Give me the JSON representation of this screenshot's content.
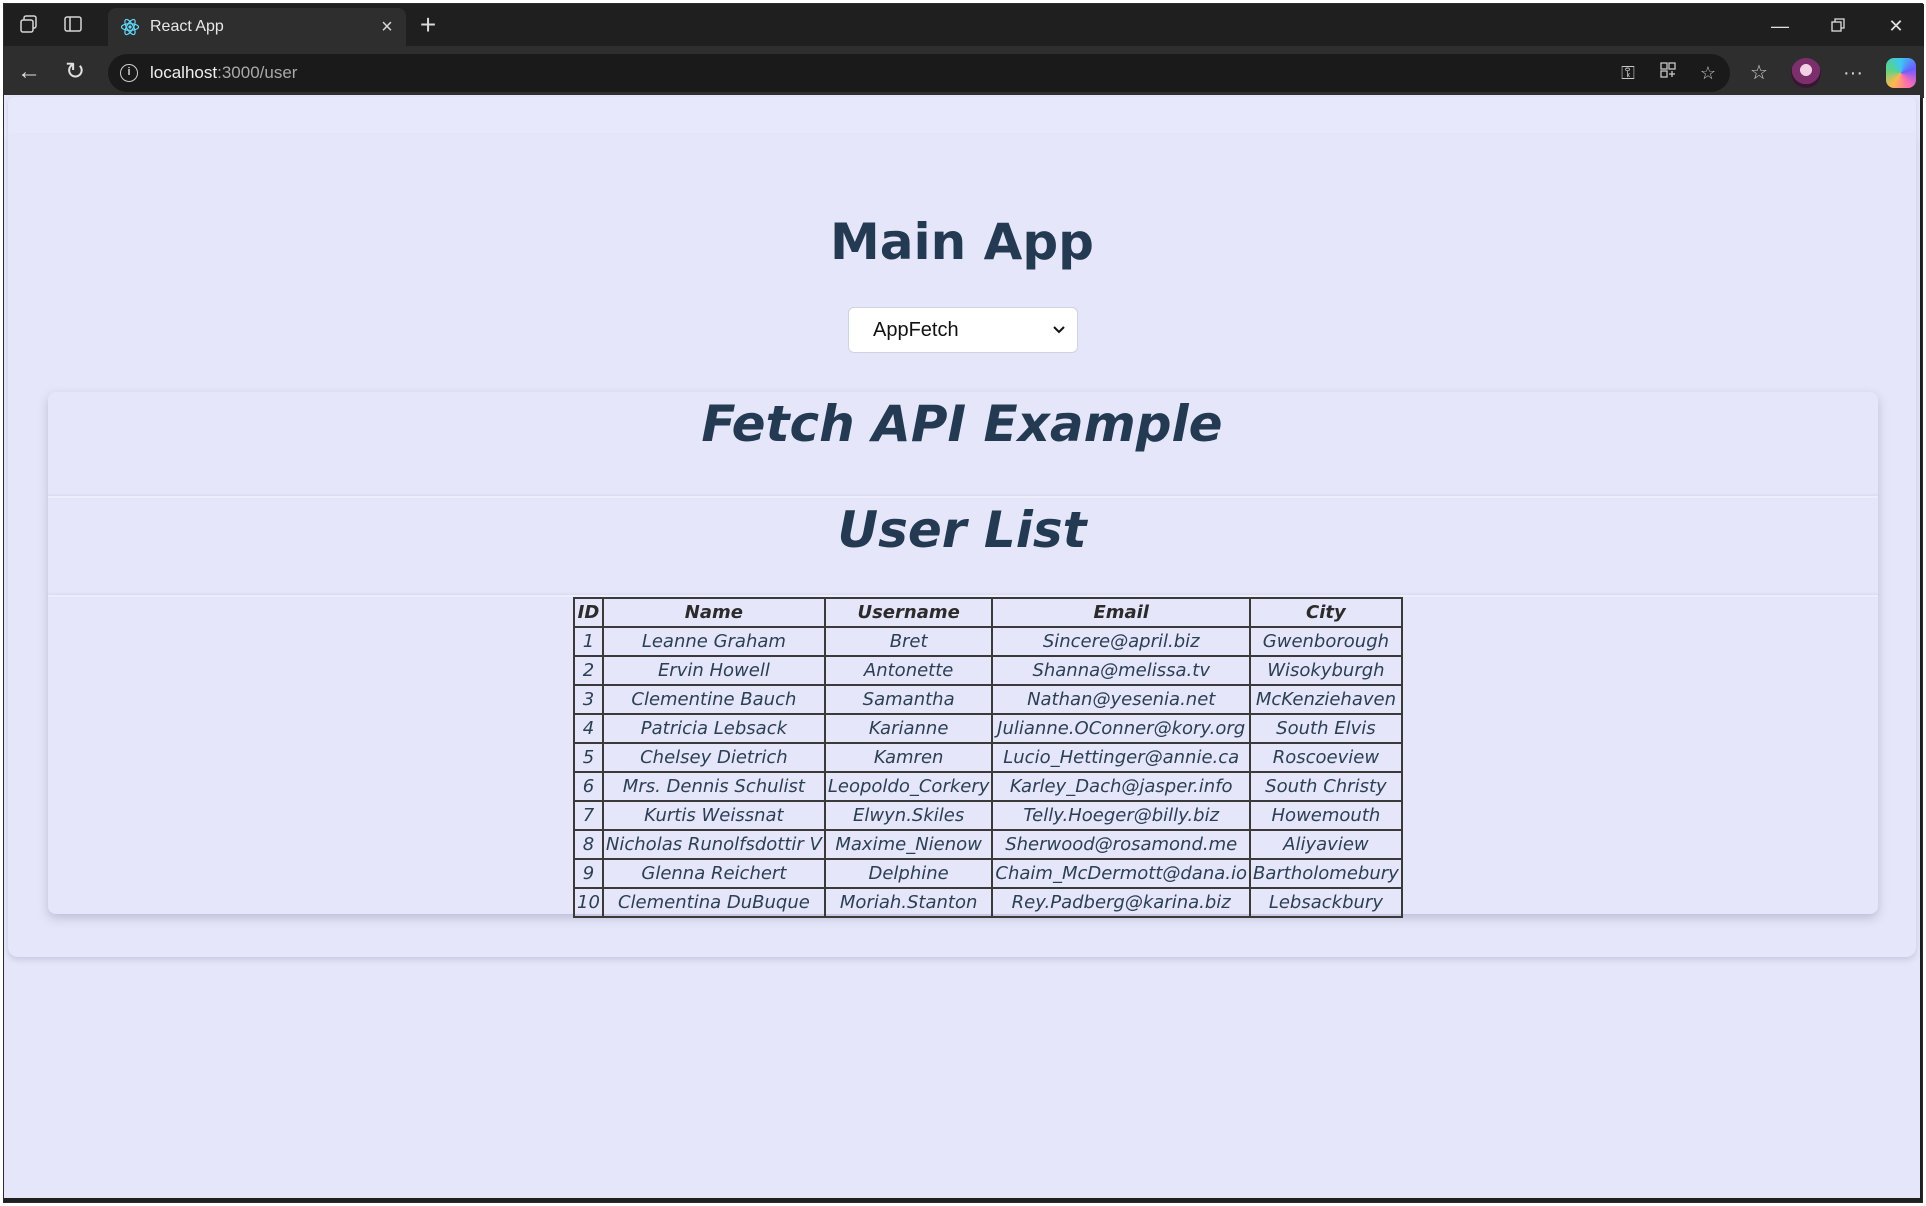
{
  "browser": {
    "tab_title": "React App",
    "url_host": "localhost",
    "url_path": ":3000/user"
  },
  "page": {
    "main_title": "Main App",
    "select": {
      "selected": "AppFetch"
    },
    "section_title": "Fetch API Example",
    "list_title": "User List",
    "table": {
      "columns": [
        "ID",
        "Name",
        "Username",
        "Email",
        "City"
      ],
      "rows": [
        [
          "1",
          "Leanne Graham",
          "Bret",
          "Sincere@april.biz",
          "Gwenborough"
        ],
        [
          "2",
          "Ervin Howell",
          "Antonette",
          "Shanna@melissa.tv",
          "Wisokyburgh"
        ],
        [
          "3",
          "Clementine Bauch",
          "Samantha",
          "Nathan@yesenia.net",
          "McKenziehaven"
        ],
        [
          "4",
          "Patricia Lebsack",
          "Karianne",
          "Julianne.OConner@kory.org",
          "South Elvis"
        ],
        [
          "5",
          "Chelsey Dietrich",
          "Kamren",
          "Lucio_Hettinger@annie.ca",
          "Roscoeview"
        ],
        [
          "6",
          "Mrs. Dennis Schulist",
          "Leopoldo_Corkery",
          "Karley_Dach@jasper.info",
          "South Christy"
        ],
        [
          "7",
          "Kurtis Weissnat",
          "Elwyn.Skiles",
          "Telly.Hoeger@billy.biz",
          "Howemouth"
        ],
        [
          "8",
          "Nicholas Runolfsdottir V",
          "Maxime_Nienow",
          "Sherwood@rosamond.me",
          "Aliyaview"
        ],
        [
          "9",
          "Glenna Reichert",
          "Delphine",
          "Chaim_McDermott@dana.io",
          "Bartholomebury"
        ],
        [
          "10",
          "Clementina DuBuque",
          "Moriah.Stanton",
          "Rey.Padberg@karina.biz",
          "Lebsackbury"
        ]
      ]
    }
  },
  "colors": {
    "page_bg": "#e5e6f9",
    "heading": "#243a52",
    "chrome_bg": "#1f1f1f"
  }
}
